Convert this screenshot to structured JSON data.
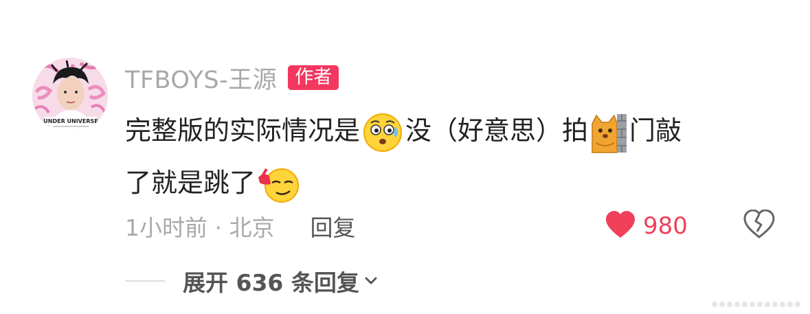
{
  "comment": {
    "author": {
      "name": "TFBOYS-王源",
      "badge": "作者",
      "avatar_caption": "UNDER UNIVERSE"
    },
    "body": {
      "part1": "完整版的实际情况是",
      "part2": "没（好意思）拍",
      "part3": "门敲",
      "part4": "了就是跳了",
      "emoji1": "sweating-worried-emoji",
      "emoji2": "cat-behind-wall-emoji",
      "emoji3": "smirking-thumbs-emoji"
    },
    "meta": {
      "time_location": "1小时前 · 北京",
      "reply_label": "回复"
    },
    "likes": {
      "count": "980",
      "icon": "heart-icon",
      "color": "#f0405a"
    },
    "dislike_icon": "broken-heart-icon",
    "expand_label": "展开 636 条回复"
  },
  "theme": {
    "badge_color": "#f3375f",
    "muted_text": "#a9a9a9",
    "body_text": "#222222"
  }
}
